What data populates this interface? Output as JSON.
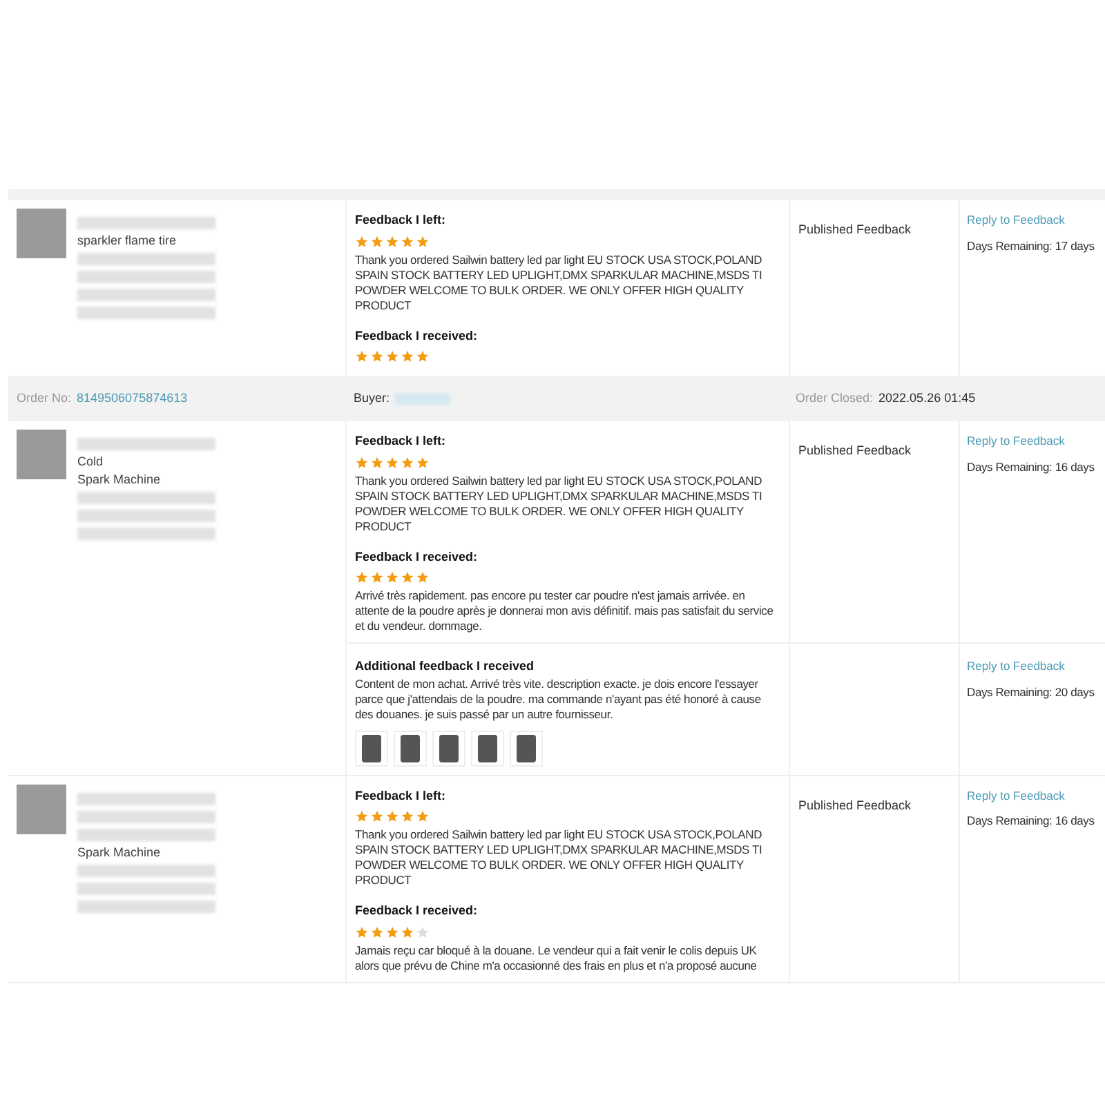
{
  "rows": [
    {
      "kind": "item",
      "product": {
        "lines": [
          {
            "kind": "blur"
          },
          {
            "kind": "text",
            "text": "sparkler flame tire"
          },
          {
            "kind": "blur"
          },
          {
            "kind": "blur"
          },
          {
            "kind": "blur"
          },
          {
            "kind": "blur"
          }
        ]
      },
      "feedback_left": {
        "label": "Feedback I left:",
        "stars": 5,
        "text": "Thank you ordered Sailwin battery led par light EU STOCK USA STOCK,POLAND SPAIN STOCK BATTERY LED UPLIGHT,DMX SPARKULAR MACHINE,MSDS TI POWDER WELCOME TO BULK ORDER. WE ONLY OFFER HIGH QUALITY PRODUCT"
      },
      "feedback_received": {
        "label": "Feedback I received:",
        "stars": 5
      },
      "status": "Published Feedback",
      "reply": "Reply to Feedback",
      "days": "Days Remaining: 17 days"
    },
    {
      "kind": "header",
      "order_label": "Order No:",
      "order_no": "8149506075874613",
      "buyer_label": "Buyer:",
      "closed_label": "Order Closed:",
      "closed": "2022.05.26 01:45"
    },
    {
      "kind": "item",
      "product": {
        "lines": [
          {
            "kind": "blur"
          },
          {
            "kind": "text",
            "text": "Cold"
          },
          {
            "kind": "text",
            "text": "Spark Machine"
          },
          {
            "kind": "blur"
          },
          {
            "kind": "blur"
          },
          {
            "kind": "blur"
          }
        ]
      },
      "feedback_left": {
        "label": "Feedback I left:",
        "stars": 5,
        "text": "Thank you ordered Sailwin battery led par light EU STOCK USA STOCK,POLAND SPAIN STOCK BATTERY LED UPLIGHT,DMX SPARKULAR MACHINE,MSDS TI POWDER WELCOME TO BULK ORDER. WE ONLY OFFER HIGH QUALITY PRODUCT"
      },
      "feedback_received": {
        "label": "Feedback I received:",
        "stars": 5,
        "text": "Arrivé très rapidement. pas encore pu tester car poudre n'est jamais arrivée. en attente de la poudre après je donnerai mon avis définitif. mais pas satisfait du service et du vendeur. dommage."
      },
      "status": "Published Feedback",
      "reply": "Reply to Feedback",
      "days": "Days Remaining: 16 days",
      "additional": {
        "label": "Additional feedback I received",
        "text": "Content de mon achat. Arrivé très vite. description exacte. je dois encore l'essayer parce que j'attendais de la poudre. ma commande n'ayant pas été honoré à cause des douanes. je suis passé par un autre fournisseur.",
        "photos": [
          {
            "kind": "photo"
          },
          {
            "kind": "photo"
          },
          {
            "kind": "photo"
          },
          {
            "kind": "photo"
          },
          {
            "kind": "photo"
          }
        ],
        "reply": "Reply to Feedback",
        "days": "Days Remaining: 20 days"
      }
    },
    {
      "kind": "item",
      "product": {
        "lines": [
          {
            "kind": "blur"
          },
          {
            "kind": "blur"
          },
          {
            "kind": "blur"
          },
          {
            "kind": "text",
            "text": "Spark Machine"
          },
          {
            "kind": "blur"
          },
          {
            "kind": "blur"
          },
          {
            "kind": "blur"
          }
        ]
      },
      "feedback_left": {
        "label": "Feedback I left:",
        "stars": 5,
        "text": "Thank you ordered Sailwin battery led par light EU STOCK USA STOCK,POLAND SPAIN STOCK BATTERY LED UPLIGHT,DMX SPARKULAR MACHINE,MSDS TI POWDER WELCOME TO BULK ORDER. WE ONLY OFFER HIGH QUALITY PRODUCT"
      },
      "feedback_received": {
        "label": "Feedback I received:",
        "stars": 4,
        "text": "Jamais reçu car bloqué à la douane. Le vendeur qui a fait venir le colis depuis UK alors que prévu de Chine m'a occasionné des frais en plus et n'a proposé aucune"
      },
      "status": "Published Feedback",
      "reply": "Reply to Feedback",
      "days": "Days Remaining: 16 days"
    }
  ]
}
